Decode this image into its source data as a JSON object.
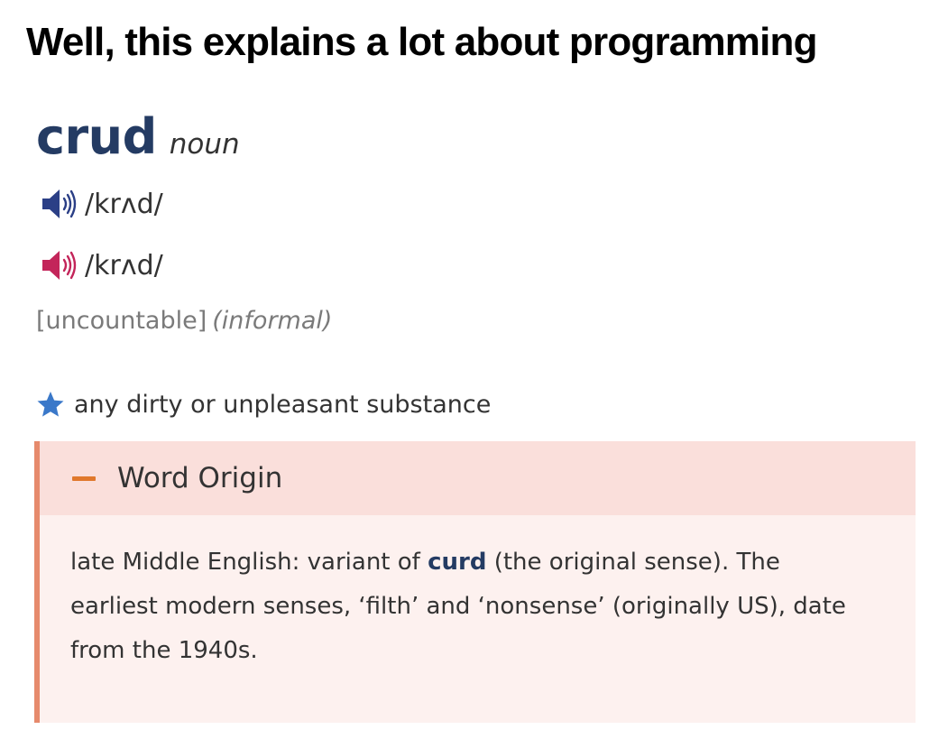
{
  "meme": {
    "title": "Well, this explains a lot about programming"
  },
  "entry": {
    "headword": "crud",
    "part_of_speech": "noun",
    "pronunciations": [
      {
        "icon": "speaker-blue-icon",
        "color": "#2b3f86",
        "ipa": "/krʌd/"
      },
      {
        "icon": "speaker-red-icon",
        "color": "#c3255a",
        "ipa": "/krʌd/"
      }
    ],
    "grammar": "[uncountable]",
    "register": "(informal)",
    "sense": {
      "icon": "star-icon",
      "star_color": "#3a78c9",
      "definition": "any dirty or unpleasant substance"
    },
    "word_origin": {
      "toggle": "collapse-minus-icon",
      "title": "Word Origin",
      "text_before": "late Middle English: variant of ",
      "link": "curd",
      "text_after": " (the original sense). The earliest modern senses, ‘filth’ and ‘nonsense’ (originally US), date from the 1940s."
    }
  },
  "colors": {
    "headword": "#243b63",
    "origin_header_bg": "#fadfdb",
    "origin_body_bg": "#fdf1ef",
    "origin_border": "#e68a6c",
    "toggle": "#e0782c"
  }
}
